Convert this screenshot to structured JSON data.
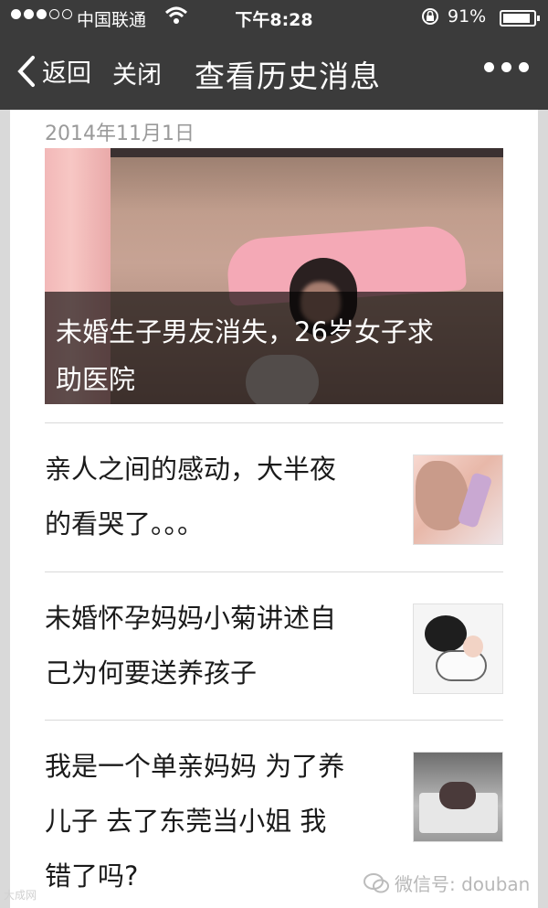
{
  "status_bar": {
    "carrier": "中国联通",
    "time": "下午8:28",
    "battery_percent": "91%",
    "battery_level": 0.91,
    "signal_bars_filled": 3,
    "signal_bars_total": 5
  },
  "nav": {
    "back_label": "返回",
    "close_label": "关闭",
    "title": "查看历史消息"
  },
  "feed": {
    "date": "2014年11月1日",
    "hero": {
      "caption_line1": "未婚生子男友消失，26岁女子求",
      "caption_line2": "助医院"
    },
    "articles": [
      {
        "line1": "亲人之间的感动，大半夜",
        "line2": "的看哭了。。。",
        "thumb": "woman-flower-thumbnail"
      },
      {
        "line1": "未婚怀孕妈妈小菊讲述自",
        "line2": "己为何要送养孩子",
        "thumb": "mother-child-sketch-thumbnail"
      },
      {
        "line1": "我是一个单亲妈妈 为了养",
        "line2": "儿子 去了东莞当小姐 我",
        "line3": "错了吗?",
        "thumb": "child-in-bed-thumbnail"
      }
    ]
  },
  "watermark": {
    "right": "微信号: douban",
    "left": "大成网"
  },
  "colors": {
    "bar_bg": "#3b3b3b",
    "page_bg": "#d9d9d9",
    "date_text": "#9a9a9a"
  }
}
